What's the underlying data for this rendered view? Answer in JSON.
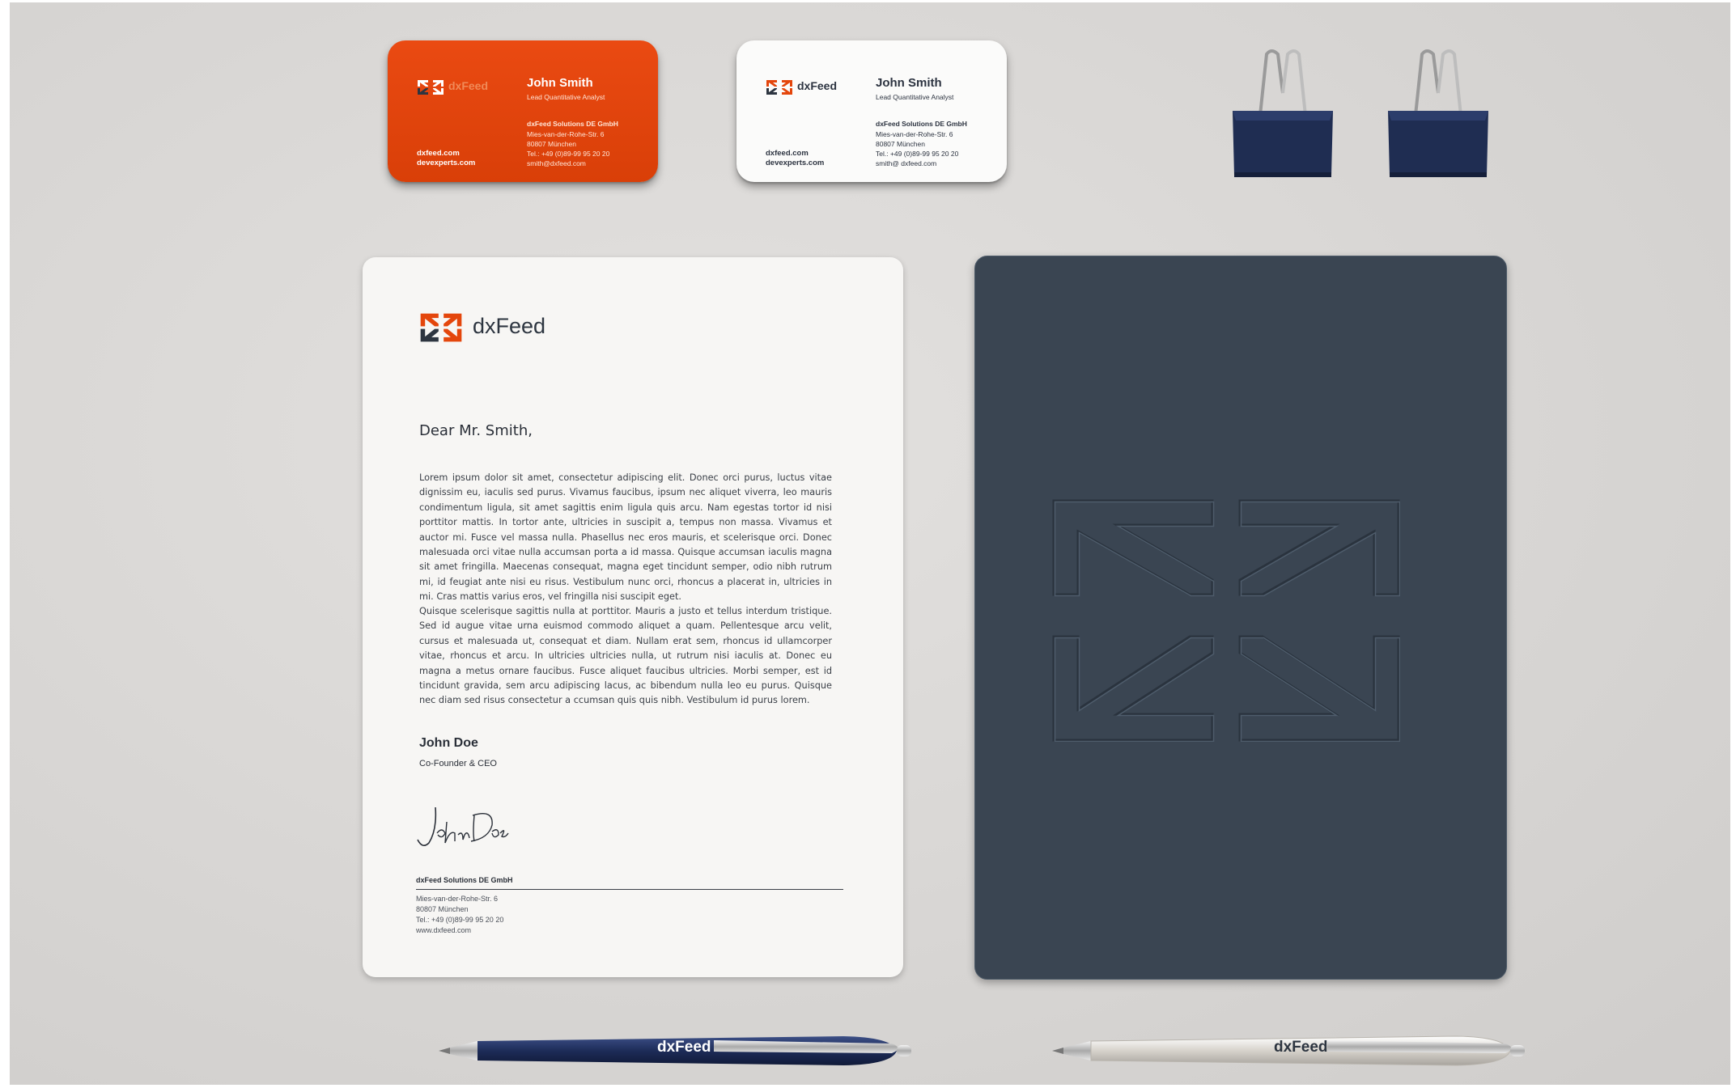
{
  "colors": {
    "brand_orange": "#e4460c",
    "brand_navy": "#2d3540",
    "folder": "#3a4552",
    "pen_blue": "#1d2c58"
  },
  "orange_card": {
    "brand": "dxFeed",
    "name": "John Smith",
    "title": "Lead Quantitative Analyst",
    "company": "dxFeed Solutions DE GmbH",
    "address": [
      "Mies-van-der-Rohe-Str. 6",
      "80807 München",
      "Tel.: +49 (0)89-99 95 20 20",
      "smith@dxfeed.com"
    ],
    "web": [
      "dxfeed.com",
      "devexperts.com"
    ]
  },
  "white_card": {
    "brand": "dxFeed",
    "name": "John Smith",
    "title": "Lead Quantitative Analyst",
    "company": "dxFeed Solutions DE GmbH",
    "address": [
      "Mies-van-der-Rohe-Str. 6",
      "80807 München",
      "Tel.: +49 (0)89-99 95 20 20",
      "smith@ dxfeed.com"
    ],
    "web": [
      "dxfeed.com",
      "devexperts.com"
    ]
  },
  "letter": {
    "brand": "dxFeed",
    "salutation": "Dear Mr. Smith,",
    "paragraphs": [
      "Lorem ipsum dolor sit amet, consectetur adipiscing elit. Donec orci purus, luctus vitae dignissim eu, iaculis sed purus. Vivamus faucibus, ipsum nec aliquet viverra, leo mauris condimentum ligula, sit amet sagittis enim ligula quis arcu. Nam egestas tortor id nisi porttitor mattis. In tortor ante, ultricies in suscipit a, tempus non massa. Vivamus et auctor mi. Fusce vel massa nulla. Phasellus nec eros mauris, et scelerisque orci. Donec malesuada orci vitae nulla accumsan porta a id massa. Quisque accumsan iaculis magna sit amet fringilla. Maecenas consequat, magna eget tincidunt semper, odio nibh rutrum mi, id feugiat ante nisi eu risus. Vestibulum nunc orci, rhoncus a placerat in, ultricies in mi. Cras mattis varius eros, vel fringilla nisi suscipit eget.",
      "Quisque scelerisque sagittis nulla at porttitor. Mauris a justo et tellus interdum tristique. Sed id augue vitae urna euismod commodo aliquet a quam. Pellentesque arcu velit, cursus et malesuada ut, consequat et diam. Nullam erat sem, rhoncus id ullamcorper vitae, rhoncus et arcu. In ultricies ultricies nulla, ut rutrum nisi iaculis at. Donec eu magna a metus ornare faucibus. Fusce aliquet faucibus ultricies. Morbi semper, est id tincidunt gravida, sem arcu adipiscing lacus, ac bibendum nulla leo eu purus. Quisque nec diam sed risus consectetur a ccumsan quis quis nibh. Vestibulum id purus lorem."
    ],
    "signer_name": "John Doe",
    "signer_role": "Co-Founder & CEO",
    "signature": "John Doe",
    "footer_company": "dxFeed Solutions DE GmbH",
    "footer_address": [
      "Mies-van-der-Rohe-Str. 6",
      "80807 München",
      "Tel.: +49 (0)89-99 95 20 20",
      "www.dxfeed.com"
    ]
  },
  "pens": {
    "blue_brand": "dxFeed",
    "silver_brand": "dxFeed"
  }
}
